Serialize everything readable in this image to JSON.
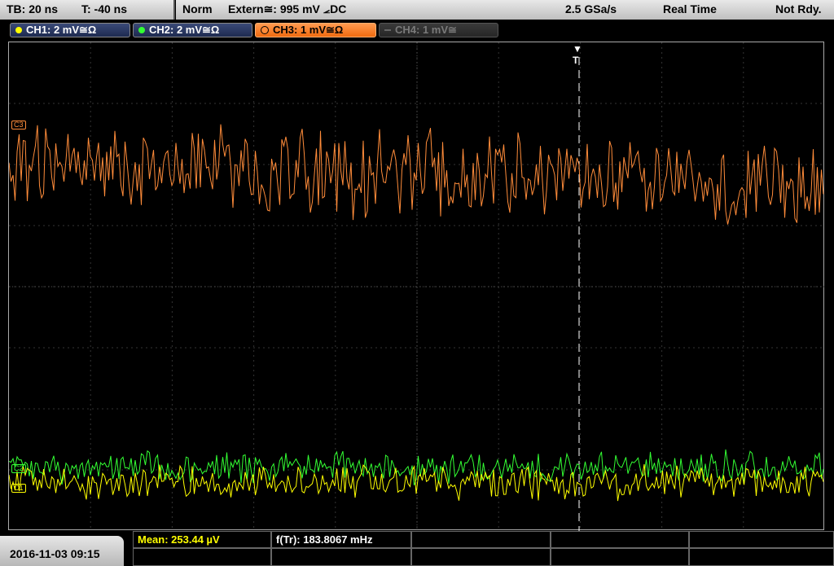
{
  "timebase": {
    "tb": "TB: 20 ns",
    "trig_pos": "T: -40 ns"
  },
  "status": {
    "mode": "Norm",
    "trigger": "Extern≅: 995 mV ⦟DC",
    "sample_rate": "2.5 GSa/s",
    "acq": "Real Time",
    "state": "Not Rdy."
  },
  "channels": [
    {
      "label": "CH1: 2 mV≅Ω",
      "color": "#ffff00",
      "state": "on"
    },
    {
      "label": "CH2: 2 mV≅Ω",
      "color": "#33ff33",
      "state": "on"
    },
    {
      "label": "CH3: 1 mV≅Ω",
      "color": "#ff8c3a",
      "state": "active"
    },
    {
      "label": "CH4: 1 mV≅",
      "color": "#777777",
      "state": "off"
    }
  ],
  "markers": {
    "ch3": "C3",
    "ch2": "C2",
    "ch1": "C1",
    "trigger": "T"
  },
  "measurements": {
    "mean": "Mean: 253.44 µV",
    "freq": "f(Tr): 183.8067 mHz"
  },
  "datetime": "2016-11-03 09:15",
  "colors": {
    "ch1": "#ffff00",
    "ch2": "#33ff33",
    "ch3": "#ff8c3a",
    "mean": "#ffff00"
  }
}
